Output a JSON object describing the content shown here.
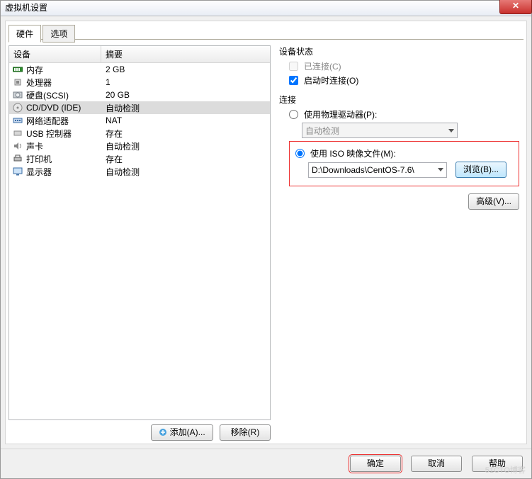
{
  "window": {
    "title": "虚拟机设置"
  },
  "tabs": {
    "hardware": "硬件",
    "options": "选项"
  },
  "table": {
    "head_device": "设备",
    "head_summary": "摘要",
    "rows": [
      {
        "name": "内存",
        "summary": "2 GB"
      },
      {
        "name": "处理器",
        "summary": "1"
      },
      {
        "name": "硬盘(SCSI)",
        "summary": "20 GB"
      },
      {
        "name": "CD/DVD (IDE)",
        "summary": "自动检测"
      },
      {
        "name": "网络适配器",
        "summary": "NAT"
      },
      {
        "name": "USB 控制器",
        "summary": "存在"
      },
      {
        "name": "声卡",
        "summary": "自动检测"
      },
      {
        "name": "打印机",
        "summary": "存在"
      },
      {
        "name": "显示器",
        "summary": "自动检测"
      }
    ]
  },
  "buttons": {
    "add": "添加(A)...",
    "remove": "移除(R)",
    "browse": "浏览(B)...",
    "advanced": "高级(V)...",
    "ok": "确定",
    "cancel": "取消",
    "help": "帮助"
  },
  "status": {
    "title": "设备状态",
    "connected": "已连接(C)",
    "connect_on_power": "启动时连接(O)"
  },
  "connection": {
    "title": "连接",
    "use_physical": "使用物理驱动器(P):",
    "physical_value": "自动检测",
    "use_iso": "使用 ISO 映像文件(M):",
    "iso_path": "D:\\Downloads\\CentOS-7.6\\"
  },
  "watermark": "51CTO博客"
}
